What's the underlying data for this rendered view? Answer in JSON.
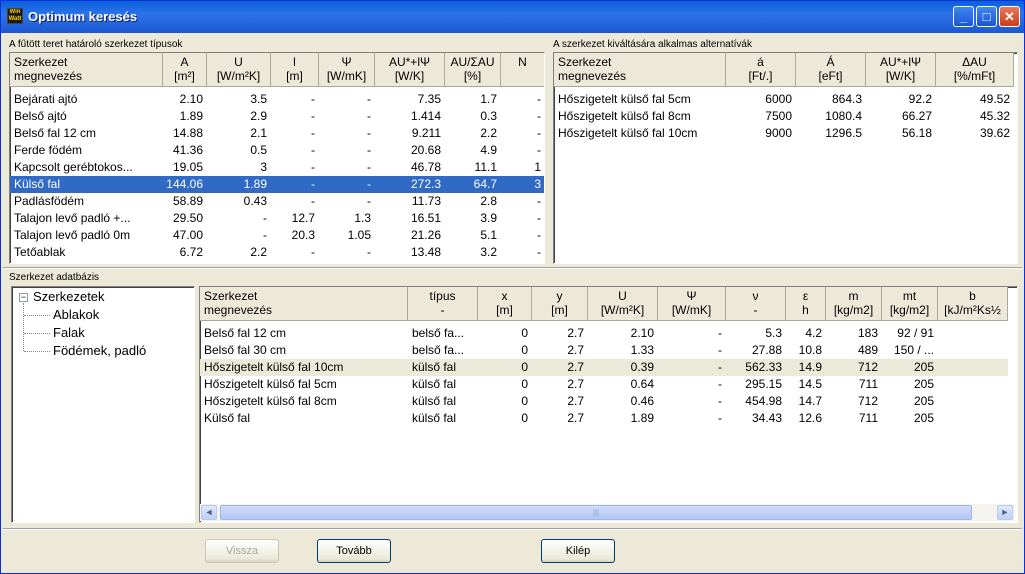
{
  "window": {
    "title": "Optimum keresés",
    "app_icon": "Win Watt"
  },
  "top_left": {
    "group_label": "A fűtött teret határoló szerkezet típusok",
    "columns": [
      {
        "l1": "Szerkezet",
        "l2": "megnevezés"
      },
      {
        "l1": "A",
        "l2": "[m²]"
      },
      {
        "l1": "U",
        "l2": "[W/m²K]"
      },
      {
        "l1": "l",
        "l2": "[m]"
      },
      {
        "l1": "Ψ",
        "l2": "[W/mK]"
      },
      {
        "l1": "AU*+lΨ",
        "l2": "[W/K]"
      },
      {
        "l1": "AU/ΣAU",
        "l2": "[%]"
      },
      {
        "l1": "N",
        "l2": ""
      }
    ],
    "rows": [
      [
        "Bejárati ajtó",
        "2.10",
        "3.5",
        "-",
        "-",
        "7.35",
        "1.7",
        "-"
      ],
      [
        "Belső ajtó",
        "1.89",
        "2.9",
        "-",
        "-",
        "1.414",
        "0.3",
        "-"
      ],
      [
        "Belső fal 12 cm",
        "14.88",
        "2.1",
        "-",
        "-",
        "9.211",
        "2.2",
        "-"
      ],
      [
        "Ferde födém",
        "41.36",
        "0.5",
        "-",
        "-",
        "20.68",
        "4.9",
        "-"
      ],
      [
        "Kapcsolt gerébtokos...",
        "19.05",
        "3",
        "-",
        "-",
        "46.78",
        "11.1",
        "1"
      ],
      [
        "Külső fal",
        "144.06",
        "1.89",
        "-",
        "-",
        "272.3",
        "64.7",
        "3"
      ],
      [
        "Padlásfödém",
        "58.89",
        "0.43",
        "-",
        "-",
        "11.73",
        "2.8",
        "-"
      ],
      [
        "Talajon levő padló +...",
        "29.50",
        "-",
        "12.7",
        "1.3",
        "16.51",
        "3.9",
        "-"
      ],
      [
        "Talajon levő padló 0m",
        "47.00",
        "-",
        "20.3",
        "1.05",
        "21.26",
        "5.1",
        "-"
      ],
      [
        "Tetőablak",
        "6.72",
        "2.2",
        "-",
        "-",
        "13.48",
        "3.2",
        "-"
      ]
    ]
  },
  "top_right": {
    "group_label": "A szerkezet kiváltására alkalmas alternatívák",
    "columns": [
      {
        "l1": "Szerkezet",
        "l2": "megnevezés"
      },
      {
        "l1": "á",
        "l2": "[Ft/.]"
      },
      {
        "l1": "Á",
        "l2": "[eFt]"
      },
      {
        "l1": "AU*+lΨ",
        "l2": "[W/K]"
      },
      {
        "l1": "ΔAU",
        "l2": "[%/mFt]"
      }
    ],
    "rows": [
      [
        "Hőszigetelt külső fal 5cm",
        "6000",
        "864.3",
        "92.2",
        "49.52"
      ],
      [
        "Hőszigetelt külső fal 8cm",
        "7500",
        "1080.4",
        "66.27",
        "45.32"
      ],
      [
        "Hőszigetelt külső fal 10cm",
        "9000",
        "1296.5",
        "56.18",
        "39.62"
      ]
    ]
  },
  "database": {
    "group_label": "Szerkezet adatbázis",
    "tree": {
      "root": "Szerkezetek",
      "children": [
        "Ablakok",
        "Falak",
        "Födémek, padló"
      ]
    },
    "columns": [
      {
        "l1": "Szerkezet",
        "l2": "megnevezés"
      },
      {
        "l1": "típus",
        "l2": "-"
      },
      {
        "l1": "x",
        "l2": "[m]"
      },
      {
        "l1": "y",
        "l2": "[m]"
      },
      {
        "l1": "U",
        "l2": "[W/m²K]"
      },
      {
        "l1": "Ψ",
        "l2": "[W/mK]"
      },
      {
        "l1": "ν",
        "l2": "-"
      },
      {
        "l1": "ε",
        "l2": "h"
      },
      {
        "l1": "m",
        "l2": "[kg/m2]"
      },
      {
        "l1": "mt",
        "l2": "[kg/m2]"
      },
      {
        "l1": "b",
        "l2": "[kJ/m²Ks½"
      }
    ],
    "rows": [
      [
        "Belső fal 12 cm",
        "belső fa...",
        "0",
        "2.7",
        "2.10",
        "-",
        "5.3",
        "4.2",
        "183",
        "92 / 91",
        ""
      ],
      [
        "Belső fal 30 cm",
        "belső fa...",
        "0",
        "2.7",
        "1.33",
        "-",
        "27.88",
        "10.8",
        "489",
        "150 / ...",
        ""
      ],
      [
        "Hőszigetelt külső fal 10cm",
        "külső fal",
        "0",
        "2.7",
        "0.39",
        "-",
        "562.33",
        "14.9",
        "712",
        "205",
        ""
      ],
      [
        "Hőszigetelt külső fal 5cm",
        "külső fal",
        "0",
        "2.7",
        "0.64",
        "-",
        "295.15",
        "14.5",
        "711",
        "205",
        ""
      ],
      [
        "Hőszigetelt külső fal 8cm",
        "külső fal",
        "0",
        "2.7",
        "0.46",
        "-",
        "454.98",
        "14.7",
        "712",
        "205",
        ""
      ],
      [
        "Külső fal",
        "külső fal",
        "0",
        "2.7",
        "1.89",
        "-",
        "34.43",
        "12.6",
        "711",
        "205",
        ""
      ]
    ]
  },
  "buttons": {
    "back": "Vissza",
    "next": "Tovább",
    "exit": "Kilép"
  }
}
